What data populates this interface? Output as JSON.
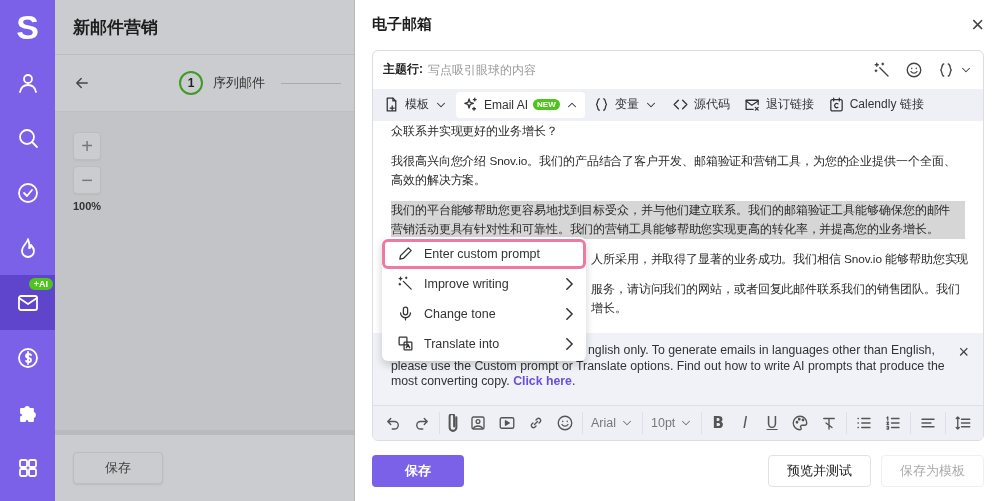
{
  "sidebar": {
    "logo": "S",
    "items": [
      {
        "kind": "person",
        "selected": false
      },
      {
        "kind": "search",
        "selected": false
      },
      {
        "kind": "check",
        "selected": false
      },
      {
        "kind": "flame",
        "selected": false
      },
      {
        "kind": "mail",
        "selected": true,
        "badge": "+AI"
      },
      {
        "kind": "dollar",
        "selected": false
      },
      {
        "kind": "puzzle",
        "selected": false
      },
      {
        "kind": "grid",
        "selected": false
      }
    ]
  },
  "campaign": {
    "title": "新邮件营销",
    "steps": [
      {
        "number": "1",
        "label": "序列邮件"
      }
    ],
    "zoom_in": "+",
    "zoom_out": "−",
    "zoom_value": "100%",
    "save_button": "保存"
  },
  "email_panel": {
    "title": "电子邮箱",
    "close": "×",
    "subject": {
      "label": "主题行:",
      "placeholder": "写点吸引眼球的内容"
    },
    "toolbar": [
      {
        "kind": "template",
        "label": "模板",
        "expanded": false
      },
      {
        "kind": "ai",
        "label": "Email AI",
        "badge": "NEW",
        "expanded": true
      },
      {
        "kind": "variable",
        "label": "变量",
        "expanded": false
      },
      {
        "kind": "code",
        "label": "源代码"
      },
      {
        "kind": "unsubscribe",
        "label": "退订链接"
      },
      {
        "kind": "calendly",
        "label": "Calendly 链接"
      }
    ],
    "body": [
      {
        "kind": "plain",
        "highlighted": false,
        "lines": [
          "众联系并实现更好的业务增长？"
        ]
      },
      {
        "kind": "plain",
        "highlighted": false,
        "lines": [
          "我很高兴向您介绍 Snov.io。我们的产品结合了客户开发、邮箱验证和营销工具，为您的企业提供一个全面、",
          "高效的解决方案。"
        ]
      },
      {
        "kind": "plain",
        "highlighted": true,
        "lines": [
          "我们的平台能够帮助您更容易地找到目标受众，并与他们建立联系。我们的邮箱验证工具能够确保您的邮件",
          "营销活动更具有针对性和可靠性。我们的营销工具能够帮助您实现更高的转化率，并提高您的业务增长。"
        ]
      },
      {
        "kind": "behind_menu",
        "highlighted": false,
        "lines": [
          "人所采用，并取得了显著的业务成功。我们相信 Snov.io 能够帮助您实现"
        ]
      },
      {
        "kind": "behind_menu",
        "highlighted": false,
        "lines": [
          "服务，请访问我们的网站，或者回复此邮件联系我们的销售团队。我们",
          "增长。"
        ]
      }
    ],
    "ai_menu": [
      {
        "kind": "pencil",
        "label": "Enter custom prompt",
        "selected": true
      },
      {
        "kind": "wand",
        "label": "Improve writing",
        "selected": false,
        "submenu": true
      },
      {
        "kind": "mic",
        "label": "Change tone",
        "selected": false,
        "submenu": true
      },
      {
        "kind": "translate",
        "label": "Translate into",
        "selected": false,
        "submenu": true
      }
    ],
    "notice": {
      "lines": [
        "nglish only. To generate emails in languages other than English,",
        "please use the Custom prompt or Translate options. Find out how to write AI prompts that produce the"
      ],
      "tail": "most converting copy. ",
      "link": "Click here",
      "end": ".",
      "close": "×"
    },
    "format_bar": [
      {
        "kind": "undo"
      },
      {
        "kind": "redo"
      },
      {
        "kind": "sep"
      },
      {
        "kind": "attach"
      },
      {
        "kind": "image"
      },
      {
        "kind": "video"
      },
      {
        "kind": "link"
      },
      {
        "kind": "emoji"
      },
      {
        "kind": "sep"
      },
      {
        "kind": "select",
        "label": "Arial"
      },
      {
        "kind": "sep"
      },
      {
        "kind": "select",
        "label": "10pt"
      },
      {
        "kind": "sep"
      },
      {
        "kind": "bold",
        "label": "B"
      },
      {
        "kind": "italic",
        "label": "I"
      },
      {
        "kind": "underline",
        "label": "U"
      },
      {
        "kind": "palette"
      },
      {
        "kind": "clear"
      },
      {
        "kind": "sep"
      },
      {
        "kind": "bullets"
      },
      {
        "kind": "numbers"
      },
      {
        "kind": "sep"
      },
      {
        "kind": "align"
      },
      {
        "kind": "sep"
      },
      {
        "kind": "spacing"
      }
    ],
    "buttons": [
      {
        "kind": "primary",
        "label": "保存",
        "disabled": false
      },
      {
        "kind": "outline",
        "label": "预览并测试",
        "disabled": false
      },
      {
        "kind": "outline",
        "label": "保存为模板",
        "disabled": true
      }
    ]
  }
}
